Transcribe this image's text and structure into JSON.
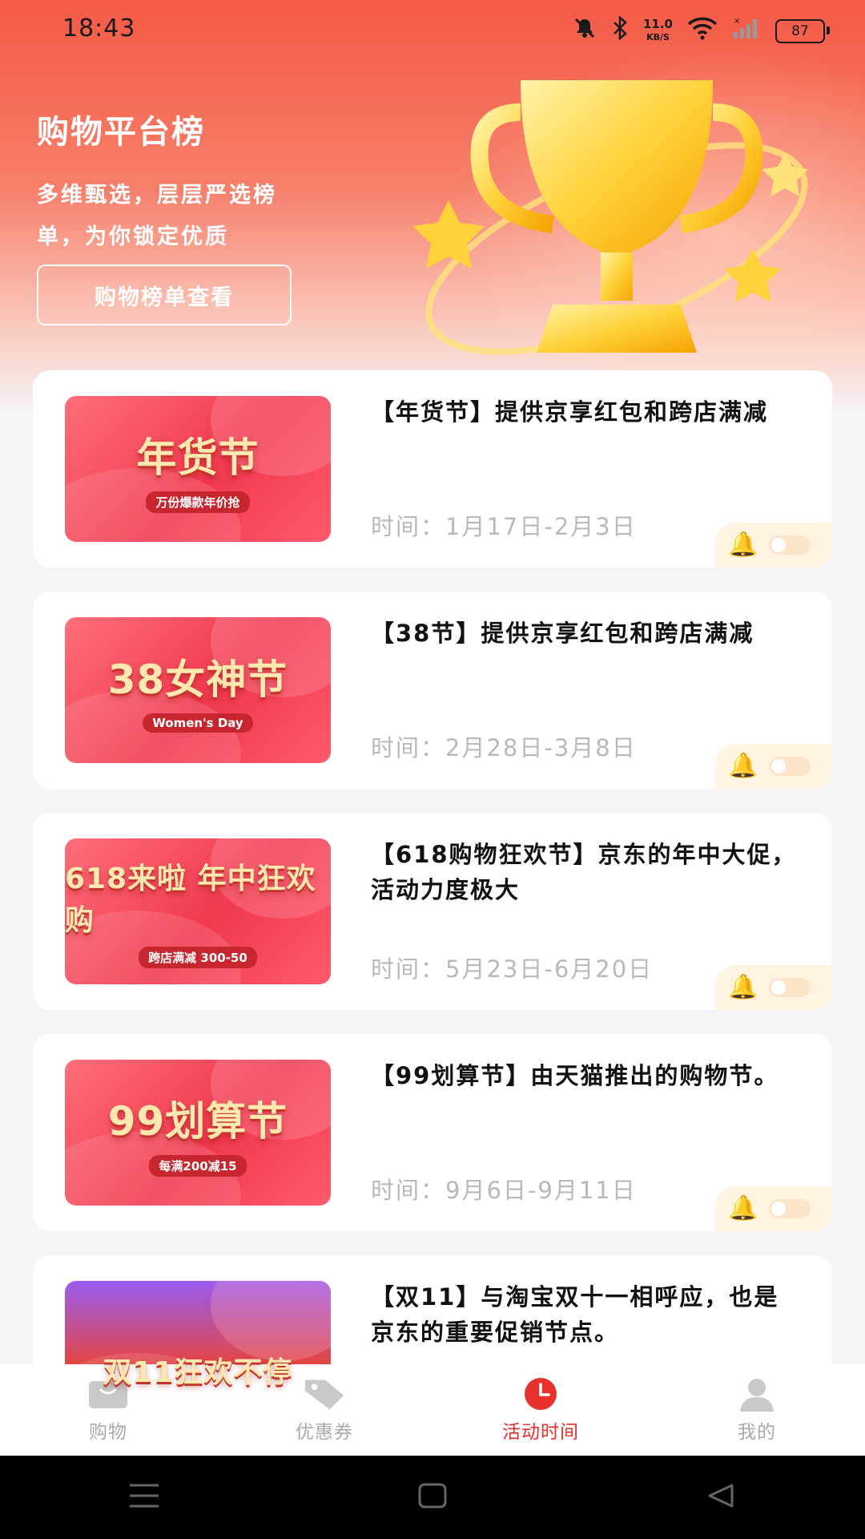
{
  "status_bar": {
    "time": "18:43",
    "net_speed_value": "11.0",
    "net_speed_unit": "KB/S",
    "battery": "87"
  },
  "hero": {
    "title": "购物平台榜",
    "subtitle": "多维甄选，层层严选榜单，为你锁定优质",
    "button_label": "购物榜单查看"
  },
  "events": [
    {
      "title": "【年货节】提供京享红包和跨店满减",
      "time": "时间：1月17日-2月3日",
      "banner_text": "年货节",
      "banner_tag": "万份爆款年价抢",
      "reminder_on": false
    },
    {
      "title": "【38节】提供京享红包和跨店满减",
      "time": "时间：2月28日-3月8日",
      "banner_text": "38女神节",
      "banner_tag": "Women's Day",
      "reminder_on": false
    },
    {
      "title": "【618购物狂欢节】京东的年中大促，活动力度极大",
      "time": "时间：5月23日-6月20日",
      "banner_text": "618来啦 年中狂欢购",
      "banner_tag": "跨店满减 300-50",
      "reminder_on": false
    },
    {
      "title": "【99划算节】由天猫推出的购物节。",
      "time": "时间：9月6日-9月11日",
      "banner_text": "99划算节",
      "banner_tag": "每满200减15",
      "reminder_on": false
    },
    {
      "title": "【双11】与淘宝双十一相呼应，也是京东的重要促销节点。",
      "time": "",
      "banner_text": "双11狂欢不停",
      "banner_tag": "",
      "reminder_on": false
    }
  ],
  "tabs": [
    {
      "label": "购物",
      "icon": "shopping-bag-icon",
      "active": false
    },
    {
      "label": "优惠券",
      "icon": "coupon-tag-icon",
      "active": false
    },
    {
      "label": "活动时间",
      "icon": "clock-icon",
      "active": true
    },
    {
      "label": "我的",
      "icon": "user-icon",
      "active": false
    }
  ],
  "colors": {
    "brand_red": "#e8302c",
    "hero_red": "#f45a46",
    "reminder_bg": "#fff3e2",
    "bell": "#f5a623"
  }
}
